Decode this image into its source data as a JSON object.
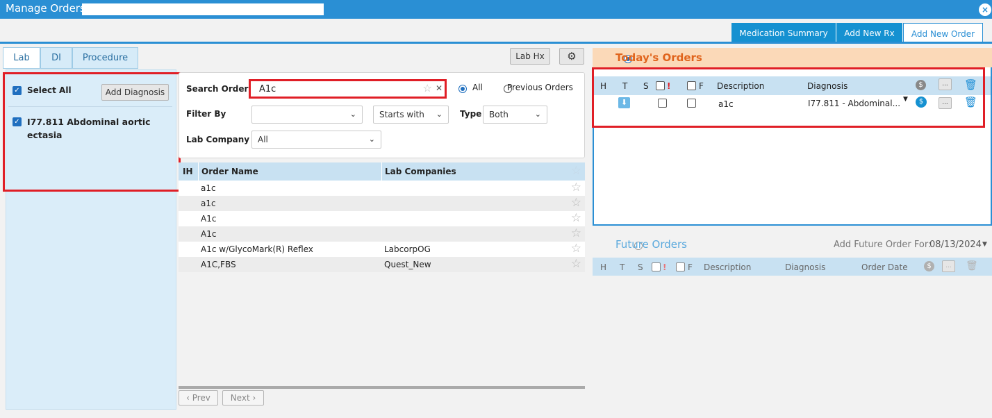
{
  "window": {
    "title": "Manage Orders"
  },
  "top_tabs": [
    {
      "label": "Medication Summary"
    },
    {
      "label": "Add New Rx"
    },
    {
      "label": "Add New Order"
    }
  ],
  "left_tabs": [
    {
      "label": "Lab"
    },
    {
      "label": "DI"
    },
    {
      "label": "Procedure"
    }
  ],
  "toolbar": {
    "lab_hx": "Lab Hx"
  },
  "diagnosis_panel": {
    "select_all": "Select All",
    "add_diagnosis": "Add Diagnosis",
    "items": [
      {
        "label": "I77.811 Abdominal aortic ectasia"
      }
    ]
  },
  "search": {
    "label": "Search Order",
    "value": "A1c",
    "radio_all": "All",
    "radio_previous": "Previous Orders",
    "filter_by_label": "Filter By",
    "filter_by_value": "",
    "match_value": "Starts with",
    "type_label": "Type",
    "type_value": "Both",
    "lab_company_label": "Lab Company",
    "lab_company_value": "All"
  },
  "order_grid": {
    "columns": [
      "IH",
      "Order Name",
      "Lab Companies"
    ],
    "rows": [
      {
        "name": "a1c",
        "company": ""
      },
      {
        "name": "a1c",
        "company": ""
      },
      {
        "name": "A1c",
        "company": ""
      },
      {
        "name": "A1c",
        "company": ""
      },
      {
        "name": "A1c w/GlycoMark(R) Reflex",
        "company": "LabcorpOG"
      },
      {
        "name": "A1C,FBS",
        "company": "Quest_New"
      }
    ]
  },
  "pager": {
    "prev": "‹ Prev",
    "next": "Next ›"
  },
  "todays_orders": {
    "title": "Today's Orders",
    "columns": {
      "h": "H",
      "t": "T",
      "s": "S",
      "urgent": "!",
      "f": "F",
      "description": "Description",
      "diagnosis": "Diagnosis"
    },
    "rows": [
      {
        "description": "a1c",
        "diagnosis": "I77.811 - Abdominal..."
      }
    ]
  },
  "future_orders": {
    "title": "Future Orders",
    "add_label": "Add Future Order For:",
    "date": "08/13/2024",
    "columns": {
      "h": "H",
      "t": "T",
      "s": "S",
      "urgent": "!",
      "f": "F",
      "description": "Description",
      "diagnosis": "Diagnosis",
      "order_date": "Order Date"
    }
  },
  "colors": {
    "accent": "#2a8fd4",
    "highlight": "#e01e26",
    "today_header": "#fbd9b8",
    "today_title": "#e0641c"
  }
}
